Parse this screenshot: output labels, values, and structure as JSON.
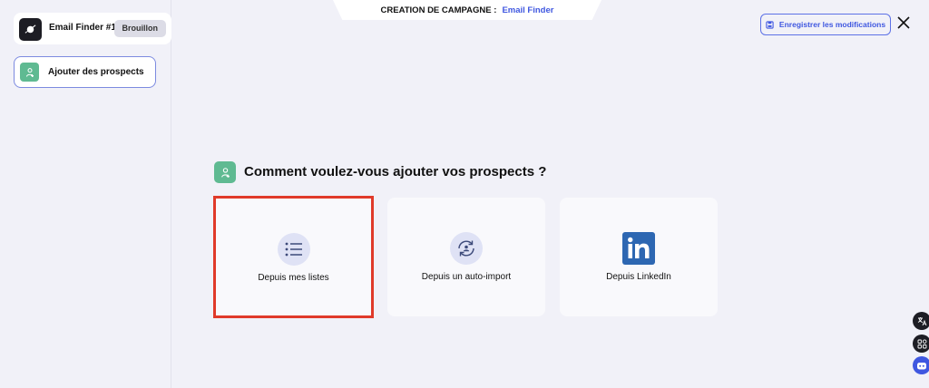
{
  "sidebar": {
    "campaign": {
      "name": "Email Finder #1",
      "status": "Brouillon"
    },
    "steps": [
      {
        "label": "Ajouter des prospects",
        "icon": "user-plus-icon",
        "color": "#5fba92"
      }
    ]
  },
  "header": {
    "title_prefix": "CREATION DE CAMPAGNE :",
    "title_value": "Email Finder",
    "save_label": "Enregistrer les modifications",
    "save_icon": "save-icon",
    "close_icon": "close-icon"
  },
  "main": {
    "question": "Comment voulez-vous ajouter vos prospects ?",
    "options": [
      {
        "label": "Depuis mes listes",
        "icon": "list-icon",
        "selected": true
      },
      {
        "label": "Depuis un auto-import",
        "icon": "auto-import-icon",
        "selected": false
      },
      {
        "label": "Depuis LinkedIn",
        "icon": "linkedin-icon",
        "selected": false
      }
    ]
  },
  "floating_buttons": [
    "translate-icon",
    "apps-icon",
    "chat-bot-icon"
  ],
  "colors": {
    "accent": "#3f57e0",
    "green": "#5fba92",
    "selection": "#e03a2a",
    "linkedin": "#2d67b2"
  }
}
